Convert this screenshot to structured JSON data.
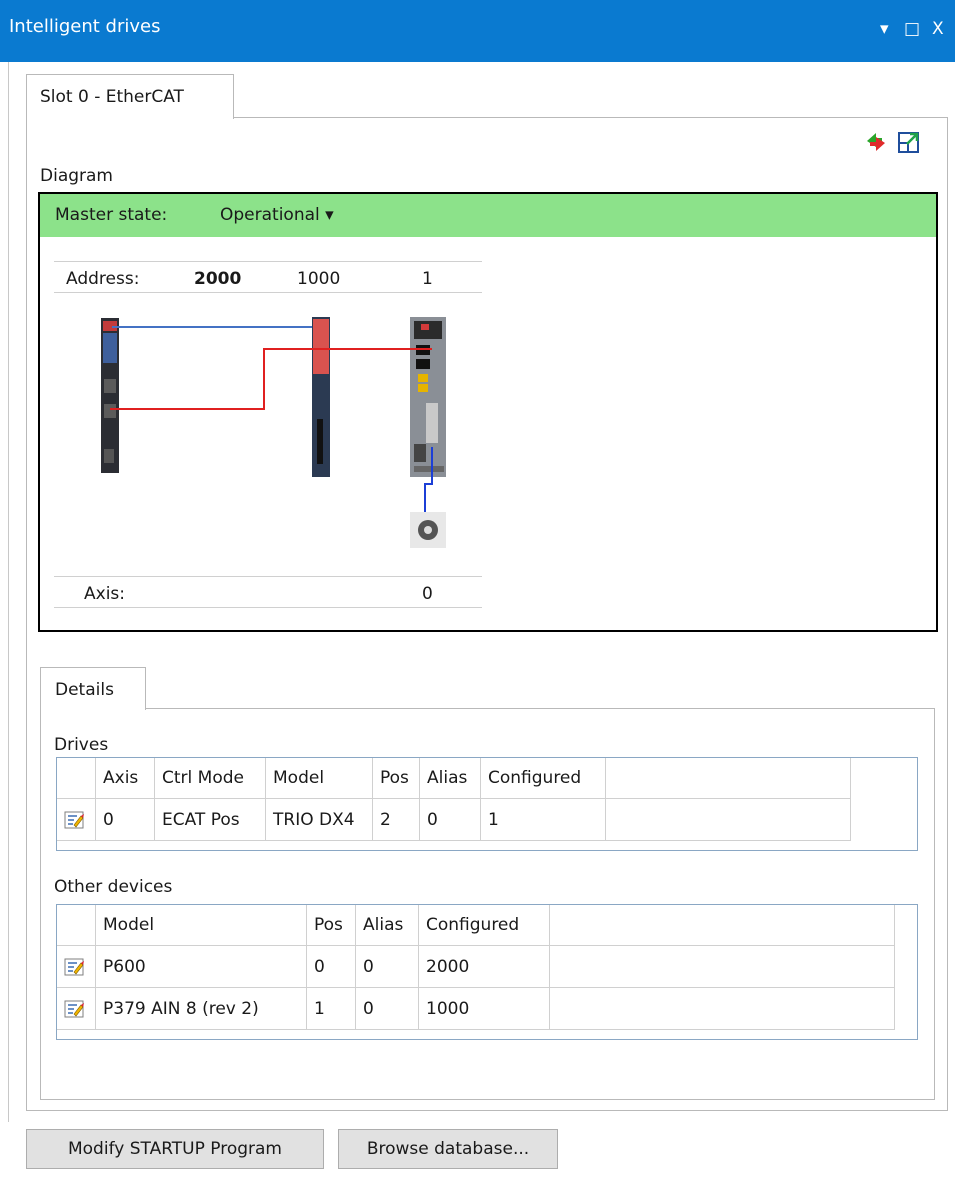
{
  "window": {
    "title": "Intelligent drives",
    "controls": [
      "▾",
      "□",
      "X"
    ]
  },
  "tabs": [
    {
      "label": "Slot 0 - EtherCAT"
    }
  ],
  "toolbar_icons": [
    "refresh-icon",
    "open-external-icon"
  ],
  "diagram": {
    "label": "Diagram",
    "master_state_label": "Master state:",
    "master_state_value": "Operational ▾",
    "master_state_color": "#8ce28a",
    "address_label": "Address:",
    "addresses": [
      "2000",
      "1000",
      "1"
    ],
    "axis_label": "Axis:",
    "axis_values": [
      "0"
    ],
    "link_colors": {
      "ethercat": "#4472c4",
      "red": "#e02020",
      "motor": "#1c3fd6"
    }
  },
  "details": {
    "tab_label": "Details",
    "drives": {
      "label": "Drives",
      "columns": [
        "",
        "Axis",
        "Ctrl Mode",
        "Model",
        "Pos",
        "Alias",
        "Configured"
      ],
      "rows": [
        [
          "edit-icon",
          "0",
          "ECAT Pos",
          "TRIO DX4",
          "2",
          "0",
          "1"
        ]
      ]
    },
    "other_devices": {
      "label": "Other devices",
      "columns": [
        "",
        "Model",
        "Pos",
        "Alias",
        "Configured"
      ],
      "rows": [
        [
          "edit-icon",
          "P600",
          "0",
          "0",
          "2000"
        ],
        [
          "edit-icon",
          "P379 AIN 8 (rev 2)",
          "1",
          "0",
          "1000"
        ]
      ]
    }
  },
  "buttons": {
    "modify_startup": "Modify STARTUP Program",
    "browse_database": "Browse database..."
  },
  "colors": {
    "title_bar": "#0a7ad0"
  }
}
